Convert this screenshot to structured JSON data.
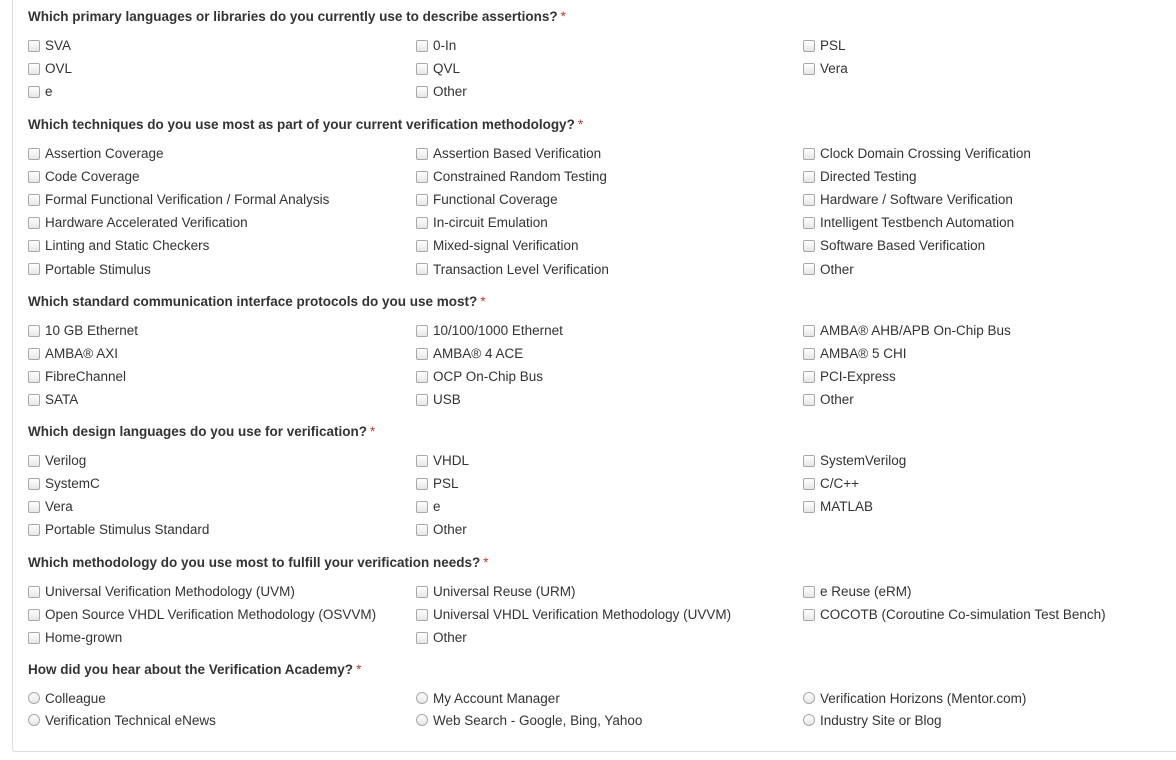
{
  "required_marker": "*",
  "questions": [
    {
      "label": "Which primary languages or libraries do you currently use to describe assertions?",
      "type": "checkbox",
      "options": [
        "SVA",
        "0-In",
        "PSL",
        "OVL",
        "QVL",
        "Vera",
        "e",
        "Other"
      ]
    },
    {
      "label": "Which techniques do you use most as part of your current verification methodology?",
      "type": "checkbox",
      "options": [
        "Assertion Coverage",
        "Assertion Based Verification",
        "Clock Domain Crossing Verification",
        "Code Coverage",
        "Constrained Random Testing",
        "Directed Testing",
        "Formal Functional Verification / Formal Analysis",
        "Functional Coverage",
        "Hardware / Software Verification",
        "Hardware Accelerated Verification",
        "In-circuit Emulation",
        "Intelligent Testbench Automation",
        "Linting and Static Checkers",
        "Mixed-signal Verification",
        "Software Based Verification",
        "Portable Stimulus",
        "Transaction Level Verification",
        "Other"
      ]
    },
    {
      "label": "Which standard communication interface protocols do you use most?",
      "type": "checkbox",
      "options": [
        "10 GB Ethernet",
        "10/100/1000 Ethernet",
        "AMBA® AHB/APB On-Chip Bus",
        "AMBA® AXI",
        "AMBA® 4 ACE",
        "AMBA® 5 CHI",
        "FibreChannel",
        "OCP On-Chip Bus",
        "PCI-Express",
        "SATA",
        "USB",
        "Other"
      ]
    },
    {
      "label": "Which design languages do you use for verification?",
      "type": "checkbox",
      "options": [
        "Verilog",
        "VHDL",
        "SystemVerilog",
        "SystemC",
        "PSL",
        "C/C++",
        "Vera",
        "e",
        "MATLAB",
        "Portable Stimulus Standard",
        "Other"
      ]
    },
    {
      "label": "Which methodology do you use most to fulfill your verification needs?",
      "type": "checkbox",
      "options": [
        "Universal Verification Methodology (UVM)",
        "Universal Reuse (URM)",
        "e Reuse (eRM)",
        "Open Source VHDL Verification Methodology (OSVVM)",
        "Universal VHDL Verification Methodology (UVVM)",
        "COCOTB (Coroutine Co-simulation Test Bench)",
        "Home-grown",
        "Other"
      ]
    },
    {
      "label": "How did you hear about the Verification Academy?",
      "type": "radio",
      "options": [
        "Colleague",
        "My Account Manager",
        "Verification Horizons (Mentor.com)",
        "Verification Technical eNews",
        "Web Search - Google, Bing, Yahoo",
        "Industry Site or Blog"
      ]
    }
  ]
}
